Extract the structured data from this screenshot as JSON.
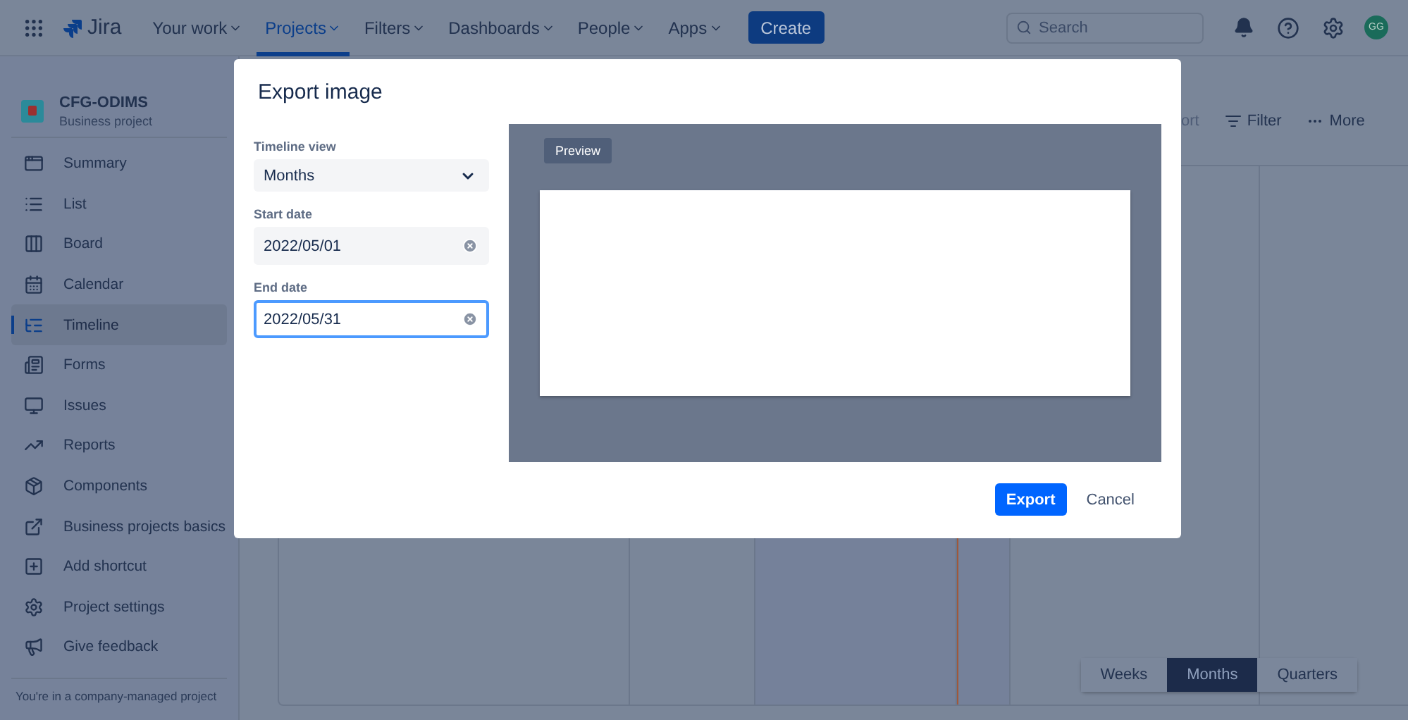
{
  "nav": {
    "logo": "Jira",
    "items": [
      {
        "label": "Your work",
        "selected": false
      },
      {
        "label": "Projects",
        "selected": true
      },
      {
        "label": "Filters",
        "selected": false
      },
      {
        "label": "Dashboards",
        "selected": false
      },
      {
        "label": "People",
        "selected": false
      },
      {
        "label": "Apps",
        "selected": false
      }
    ],
    "create": "Create",
    "search": {
      "placeholder": "Search"
    },
    "avatar": "GG"
  },
  "project": {
    "name": "CFG-ODIMS",
    "type": "Business project"
  },
  "sidebar": {
    "items": [
      {
        "label": "Summary",
        "selected": false
      },
      {
        "label": "List",
        "selected": false
      },
      {
        "label": "Board",
        "selected": false
      },
      {
        "label": "Calendar",
        "selected": false
      },
      {
        "label": "Timeline",
        "selected": true
      },
      {
        "label": "Forms",
        "selected": false
      },
      {
        "label": "Issues",
        "selected": false
      },
      {
        "label": "Reports",
        "selected": false
      },
      {
        "label": "Components",
        "selected": false
      },
      {
        "label": "Business projects basics",
        "selected": false
      },
      {
        "label": "Add shortcut",
        "selected": false
      },
      {
        "label": "Project settings",
        "selected": false
      },
      {
        "label": "Give feedback",
        "selected": false
      }
    ],
    "footer": "You're in a company-managed project"
  },
  "toolbar": [
    "ort",
    "Filter",
    "More"
  ],
  "zoom_levels": [
    {
      "label": "Weeks",
      "selected": false
    },
    {
      "label": "Months",
      "selected": true
    },
    {
      "label": "Quarters",
      "selected": false
    }
  ],
  "dialog": {
    "title": "Export image",
    "fields": [
      {
        "kind": "select",
        "label": "Timeline view",
        "value": "Months"
      },
      {
        "kind": "date",
        "label": "Start date",
        "value": "2022/05/01",
        "focused": false
      },
      {
        "kind": "date",
        "label": "End date",
        "value": "2022/05/31",
        "focused": true
      }
    ],
    "preview_tag": "Preview",
    "buttons": [
      {
        "label": "Export",
        "kind": "primary"
      },
      {
        "label": "Cancel",
        "kind": "subtle"
      }
    ]
  }
}
